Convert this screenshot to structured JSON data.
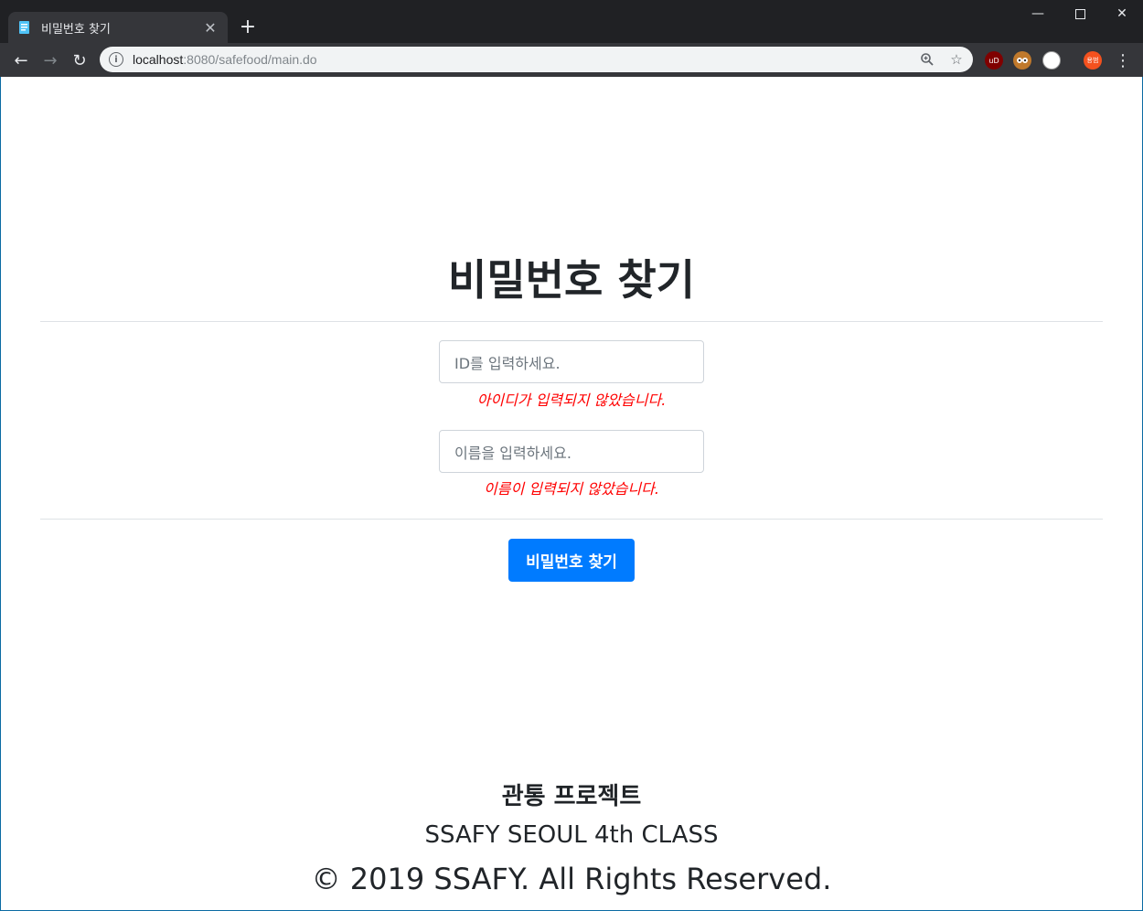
{
  "browser": {
    "tab_title": "비밀번호 찾기",
    "url_host": "localhost",
    "url_rest": ":8080/safefood/main.do",
    "profile_label": "용범",
    "ext_ublock": "uD"
  },
  "page": {
    "title": "비밀번호 찾기",
    "id_field": {
      "placeholder": "ID를 입력하세요.",
      "error": "아이디가 입력되지 않았습니다."
    },
    "name_field": {
      "placeholder": "이름을 입력하세요.",
      "error": "이름이 입력되지 않았습니다."
    },
    "submit_label": "비밀번호 찾기"
  },
  "footer": {
    "project": "관통 프로젝트",
    "class_name": "SSAFY SEOUL 4th CLASS",
    "copyright": "© 2019 SSAFY. All Rights Reserved."
  },
  "colors": {
    "accent": "#007bff",
    "error": "#ff0000",
    "chrome_dark": "#202124"
  }
}
